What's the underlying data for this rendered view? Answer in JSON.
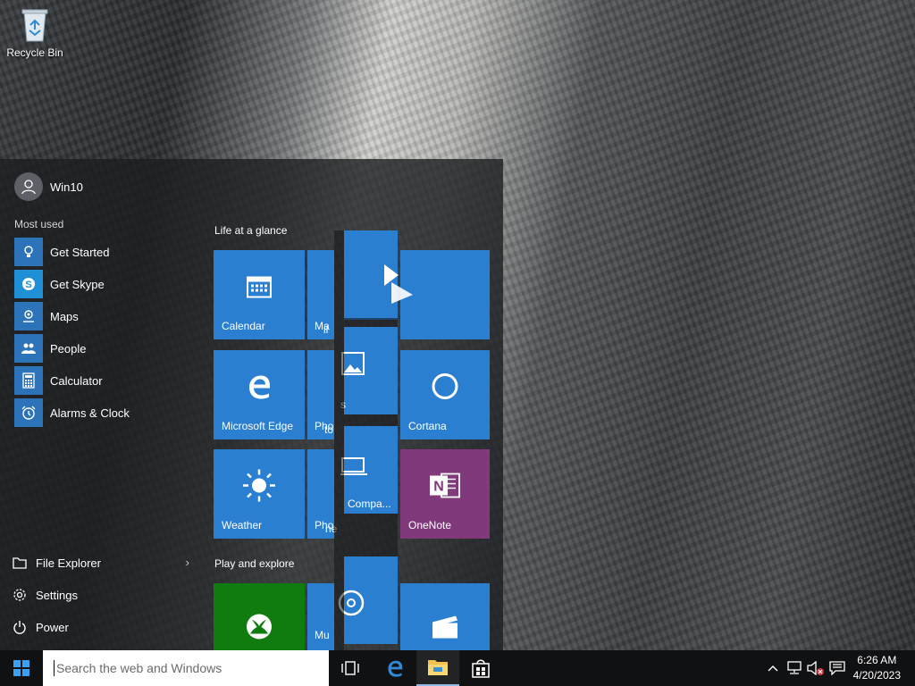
{
  "desktop": {
    "recycle_bin_label": "Recycle Bin"
  },
  "start_menu": {
    "user_name": "Win10",
    "most_used_label": "Most used",
    "apps": [
      {
        "label": "Get Started",
        "icon": "lightbulb-icon"
      },
      {
        "label": "Get Skype",
        "icon": "skype-icon"
      },
      {
        "label": "Maps",
        "icon": "maps-icon"
      },
      {
        "label": "People",
        "icon": "people-icon"
      },
      {
        "label": "Calculator",
        "icon": "calculator-icon"
      },
      {
        "label": "Alarms & Clock",
        "icon": "alarm-clock-icon"
      }
    ],
    "bottom": {
      "file_explorer": "File Explorer",
      "settings": "Settings",
      "power": "Power"
    },
    "groups": {
      "life": "Life at a glance",
      "play": "Play and explore"
    },
    "tiles": {
      "calendar": "Calendar",
      "mail_partial": "Ma",
      "mail_partial2": "il",
      "edge": "Microsoft Edge",
      "photos_partial": "Pho",
      "photos_partial2": "to",
      "photos_partial3": "s",
      "cortana": "Cortana",
      "weather": "Weather",
      "phone_partial": "Pho",
      "phone_partial2": "ne",
      "phone_compan": "Compa...",
      "onenote": "OneNote",
      "music_partial": "Mu"
    },
    "colors": {
      "tile_blue": "#2b7fd0",
      "onenote_purple": "#80397b",
      "xbox_green": "#107c10"
    }
  },
  "taskbar": {
    "search_placeholder": "Search the web and Windows",
    "time": "6:26 AM",
    "date": "4/20/2023"
  }
}
